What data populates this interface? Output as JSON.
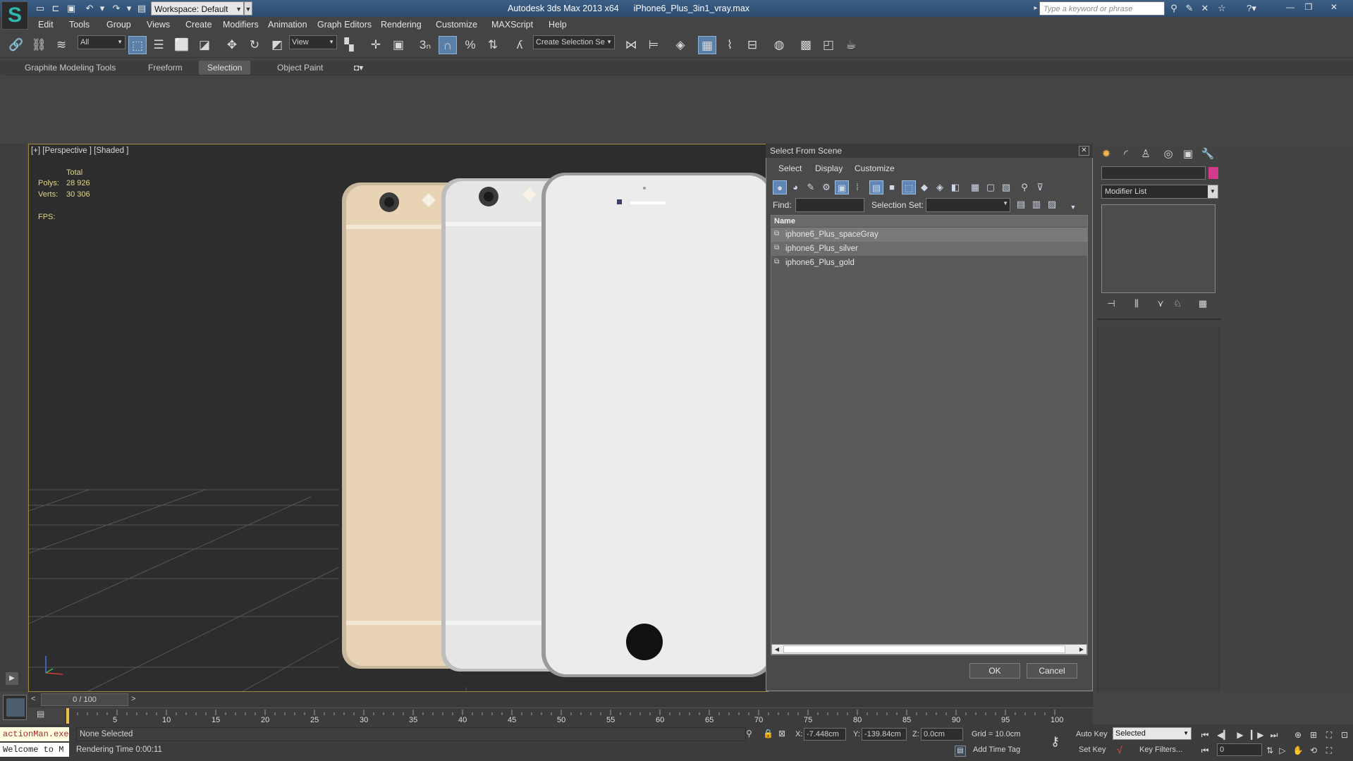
{
  "titlebar": {
    "workspace": "Workspace: Default",
    "app_title": "Autodesk 3ds Max  2013 x64",
    "file_name": "iPhone6_Plus_3in1_vray.max",
    "search_placeholder": "Type a keyword or phrase"
  },
  "menu": [
    "Edit",
    "Tools",
    "Group",
    "Views",
    "Create",
    "Modifiers",
    "Animation",
    "Graph Editors",
    "Rendering",
    "Customize",
    "MAXScript",
    "Help"
  ],
  "toolbar": {
    "filter_value": "All",
    "ref_coord_value": "View",
    "snap_label": "3",
    "named_sel_placeholder": "Create Selection Se"
  },
  "ribbon": {
    "tabs": [
      "Graphite Modeling Tools",
      "Freeform",
      "Selection",
      "Object Paint"
    ],
    "active_tab": "Selection"
  },
  "viewport": {
    "label": "[+] [Perspective ] [Shaded ]",
    "stats_header": "Total",
    "polys_label": "Polys:",
    "polys_value": "28 926",
    "verts_label": "Verts:",
    "verts_value": "30 306",
    "fps_label": "FPS:",
    "colors": {
      "phone_gold": "#e8d3b5",
      "phone_silver": "#e6e6e6",
      "phone_white": "#ececec",
      "grid": "#555555"
    }
  },
  "dialog": {
    "title": "Select From Scene",
    "menus": [
      "Select",
      "Display",
      "Customize"
    ],
    "find_label": "Find:",
    "selset_label": "Selection Set:",
    "column_header": "Name",
    "rows": [
      "iphone6_Plus_spaceGray",
      "iphone6_Plus_silver",
      "iphone6_Plus_gold"
    ],
    "ok_label": "OK",
    "cancel_label": "Cancel"
  },
  "command_panel": {
    "modifier_list": "Modifier List",
    "color_swatch": "#d43a8c"
  },
  "timeline": {
    "slider_text": "0 / 100",
    "ticks": [
      "5",
      "10",
      "15",
      "20",
      "25",
      "30",
      "35",
      "40",
      "45",
      "50",
      "55",
      "60",
      "65",
      "70",
      "75",
      "80",
      "85",
      "90",
      "95",
      "100"
    ],
    "max_frame": 100
  },
  "status": {
    "maxscript_line1": "actionMan.exe",
    "maxscript_line2": "Welcome to M",
    "prompt": "None Selected",
    "render_time": "Rendering Time  0:00:11",
    "x_label": "X:",
    "x_value": "-7.448cm",
    "y_label": "Y:",
    "y_value": "-139.84cm",
    "z_label": "Z:",
    "z_value": "0.0cm",
    "grid": "Grid = 10.0cm",
    "add_time_tag": "Add Time Tag",
    "auto_key": "Auto Key",
    "set_key": "Set Key",
    "selected_dd": "Selected",
    "key_filters": "Key Filters...",
    "frame_value": "0"
  }
}
